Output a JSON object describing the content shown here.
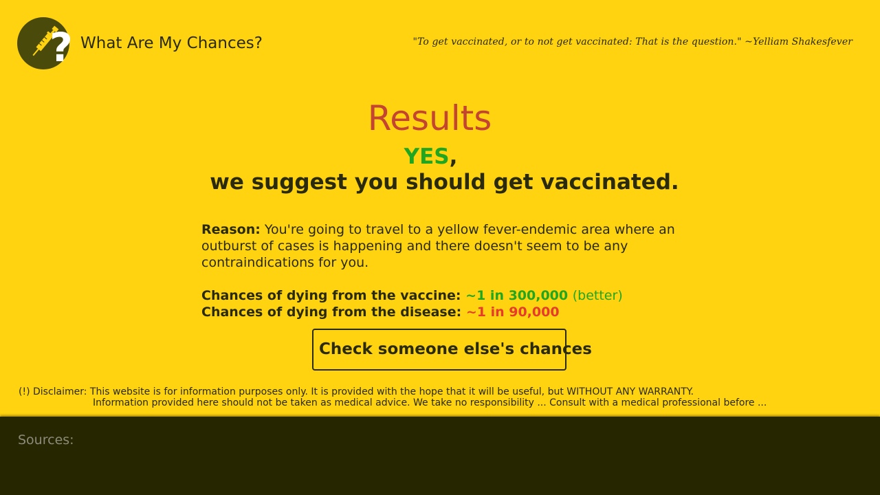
{
  "header": {
    "site_title": "What Are My Chances?",
    "quote": "\"To get vaccinated, or to not get vaccinated: That is the question.\" ~Yelliam Shakesfever",
    "logo_icon": "syringe-question-icon"
  },
  "results": {
    "heading": "Results",
    "verdict_yes": "YES",
    "verdict_comma": ",",
    "verdict_main": "we suggest you should get vaccinated.",
    "reason_label": "Reason:",
    "reason_text": " You're going to travel to a yellow fever-endemic area where an outburst of cases is happening and there doesn't seem to be any contraindications for you.",
    "vaccine_label": "Chances of dying from the vaccine:",
    "vaccine_value": "~1 in 300,000",
    "vaccine_note": "(better)",
    "disease_label": "Chances of dying from the disease:",
    "disease_value": "~1 in 90,000",
    "check_button_label": "Check someone else's chances"
  },
  "disclaimer": {
    "line1": "(!) Disclaimer: This website is for information purposes only. It is provided with the hope that it will be useful, but WITHOUT ANY WARRANTY.",
    "line2": "Information provided here should not be taken as medical advice. We take no responsibility ... Consult with a medical professional before ..."
  },
  "footer": {
    "sources_label": "Sources:"
  },
  "colors": {
    "background": "#ffd30f",
    "accent_red": "#c44432",
    "good_green": "#21a621",
    "bad_red": "#e73a2c",
    "footer_bg": "#262600",
    "text_dark": "#2a2a0c"
  }
}
